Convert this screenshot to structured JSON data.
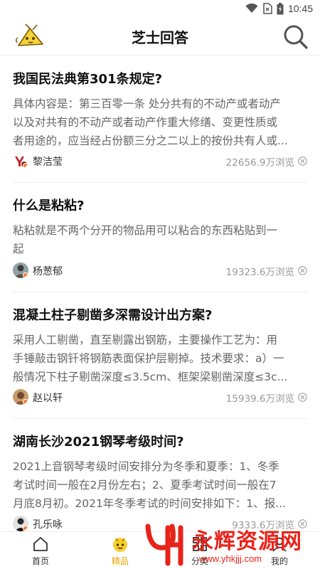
{
  "status_bar": {
    "time": "10:45",
    "icons": [
      "wifi-icon",
      "sim-icon",
      "battery-icon"
    ]
  },
  "header": {
    "title": "芝士回答",
    "logo": "cheese-mascot-logo",
    "search_icon": "search-icon"
  },
  "questions": [
    {
      "title": "我国民法典第301条规定?",
      "excerpt": [
        "具体内容是：第三百零一条 处分共有的不动产或者动产",
        "以及对共有的不动产或者动产作重大修缮、变更性质或",
        "者用途的，应当经占份额三分之二以上的按份共有人或..."
      ],
      "author": "黎洁莹",
      "views": "22656.9万浏览"
    },
    {
      "title": "什么是粘粘?",
      "excerpt": [
        "粘粘就是不两个分开的物品用可以粘合的东西粘贴到一",
        "起"
      ],
      "author": "杨葱郁",
      "views": "19323.6万浏览"
    },
    {
      "title": "混凝土柱子剔凿多深需设计出方案?",
      "excerpt": [
        "采用人工剔凿，直至剔露出钢筋，主要操作工艺为：用",
        "手锤敲击钢钎将钢筋表面保护层剔掉。技术要求：a）一",
        "般情况下柱子剔凿深度≤3.5cm、框架梁剔凿深度≤3c..."
      ],
      "author": "赵以轩",
      "views": "15939.6万浏览"
    },
    {
      "title": "湖南长沙2021钢琴考级时间?",
      "excerpt": [
        "2021上音钢琴考级时间安排分为冬季和夏季：1、冬季",
        "考试时间一般在2月份左右；2、夏季考试时间一般在7",
        "月底8月初。2021年冬季考试的时间安排如下：1、报..."
      ],
      "author": "孔乐咏",
      "views": "9333.6万浏览"
    }
  ],
  "bottom_nav": [
    {
      "label": "首页",
      "icon": "home-icon"
    },
    {
      "label": "精品",
      "icon": "featured-icon",
      "active": true
    },
    {
      "label": "分类",
      "icon": "category-icon"
    },
    {
      "label": "我的",
      "icon": "profile-icon"
    }
  ],
  "watermark": {
    "title": "永辉资源网",
    "url": "www.yhkjjj.com"
  },
  "colors": {
    "accent": "#e8a400",
    "watermark": "#e8231a",
    "text_secondary": "#666666",
    "views": "#999999"
  }
}
